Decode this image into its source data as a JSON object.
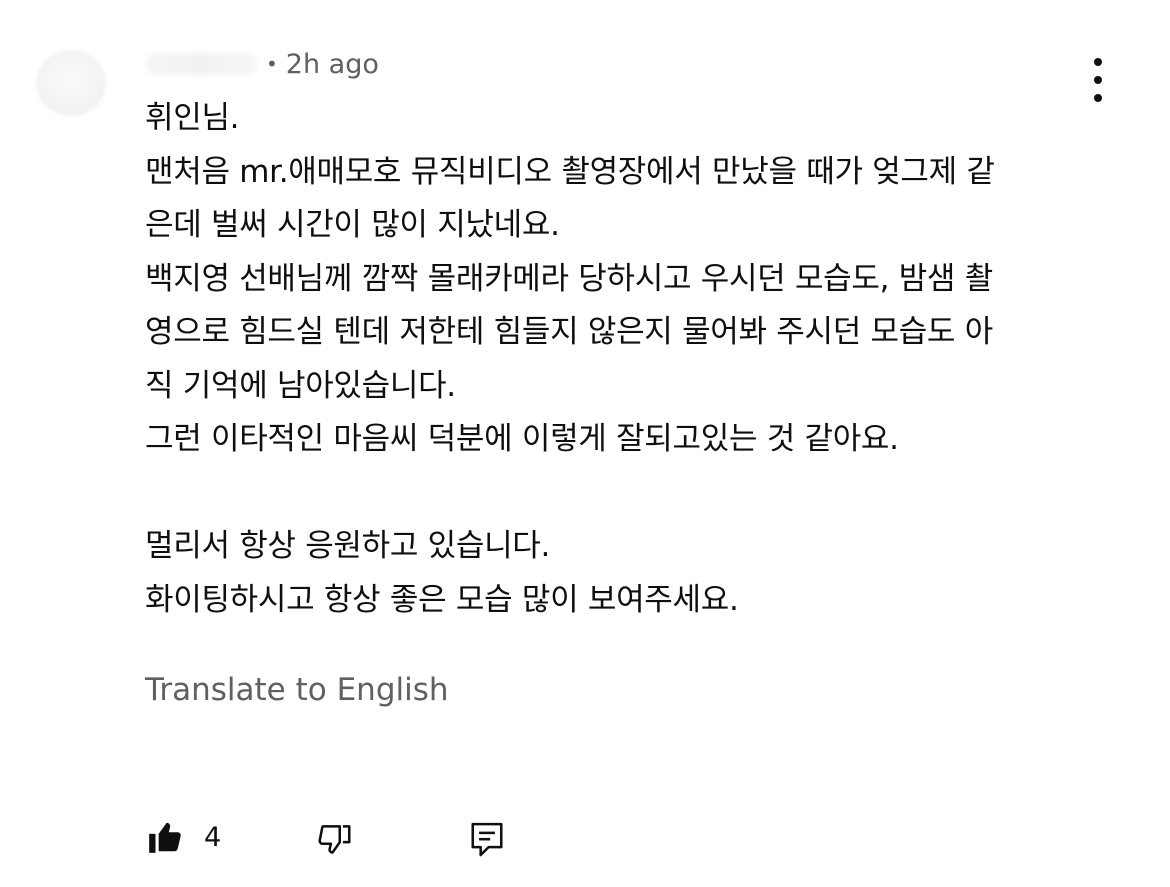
{
  "comment": {
    "time": "2h ago",
    "separator": "•",
    "lines": [
      "휘인님.",
      "맨처음 mr.애매모호 뮤직비디오 촬영장에서 만났을 때가 엊그제 같",
      "은데 벌써 시간이 많이 지났네요.",
      "백지영 선배님께 깜짝 몰래카메라 당하시고 우시던 모습도, 밤샘 촬",
      "영으로 힘드실 텐데 저한테 힘들지 않은지 물어봐 주시던 모습도 아",
      "직 기억에 남아있습니다.",
      "그런 이타적인 마음씨 덕분에 이렇게 잘되고있는 것 같아요.",
      "",
      "멀리서 항상 응원하고 있습니다.",
      "화이팅하시고 항상 좋은 모습 많이 보여주세요."
    ],
    "translate_label": "Translate to English",
    "like_count": "4"
  },
  "icons": {
    "like": "thumbs-up-filled-icon",
    "dislike": "thumbs-down-outline-icon",
    "reply": "reply-comment-icon",
    "more": "more-vertical-icon"
  }
}
